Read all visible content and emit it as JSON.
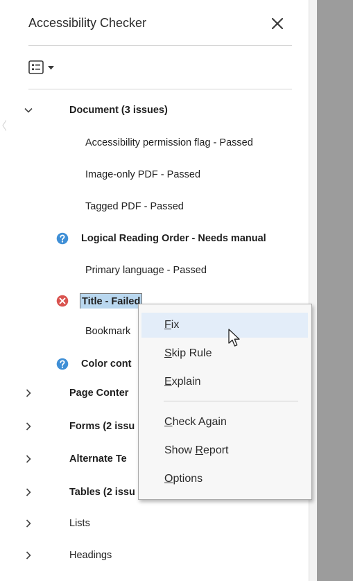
{
  "panel": {
    "title": "Accessibility Checker"
  },
  "tree": {
    "document_header": "Document (3 issues)",
    "document_items": [
      "Accessibility permission flag - Passed",
      "Image-only PDF - Passed",
      "Tagged PDF - Passed",
      "Logical Reading Order - Needs manual",
      "Primary language - Passed",
      "Title - Failed",
      "Bookmark",
      "Color cont"
    ],
    "categories": [
      "Page Conter",
      "Forms (2 issu",
      "Alternate Te",
      "Tables (2 issu",
      "Lists",
      "Headings"
    ]
  },
  "context_menu": {
    "items": [
      "Fix",
      "Skip Rule",
      "Explain",
      "Check Again",
      "Show Report",
      "Options"
    ],
    "underlined_letters": [
      "F",
      "S",
      "E",
      "C",
      "R",
      "O"
    ]
  },
  "icons": {
    "close": "close-icon",
    "options": "list-options-icon",
    "expanded": "chevron-down-icon",
    "collapsed": "chevron-right-icon",
    "needs_manual": "question-icon",
    "failed": "error-icon",
    "cursor": "mouse-pointer-icon"
  },
  "colors": {
    "question_icon": "#3f8fd6",
    "failed_icon": "#d9534f",
    "selection_fill": "#b9d7ef",
    "menu_hover": "#e3edf9",
    "document_bg": "#9c9c9c"
  }
}
